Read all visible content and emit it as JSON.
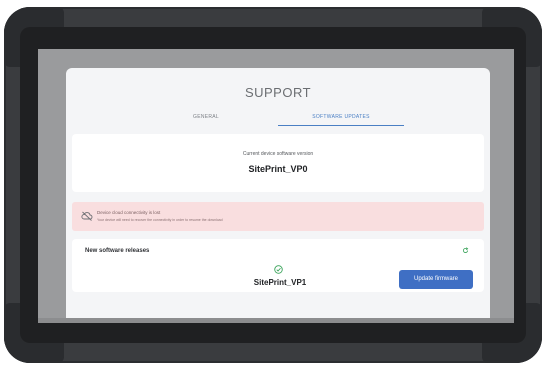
{
  "page": {
    "title": "SUPPORT"
  },
  "tabs": [
    {
      "label": "GENERAL",
      "active": false
    },
    {
      "label": "SOFTWARE UPDATES",
      "active": true
    }
  ],
  "current_version": {
    "label": "Current device software version",
    "value": "SitePrint_VP0"
  },
  "alert": {
    "icon": "cloud-off-icon",
    "heading": "Device cloud connectivity is lost",
    "detail": "Your device will need to recover the connectivity in order to resume the download"
  },
  "releases": {
    "heading": "New software releases",
    "refresh_icon": "refresh-icon",
    "status_icon": "check-circle-icon",
    "release_name": "SitePrint_VP1",
    "update_button": "Update firmware"
  },
  "colors": {
    "accent": "#3f6fc4",
    "alert_bg": "#f9dedf",
    "success": "#3aa35a",
    "device_body": "#3a3c3f"
  }
}
